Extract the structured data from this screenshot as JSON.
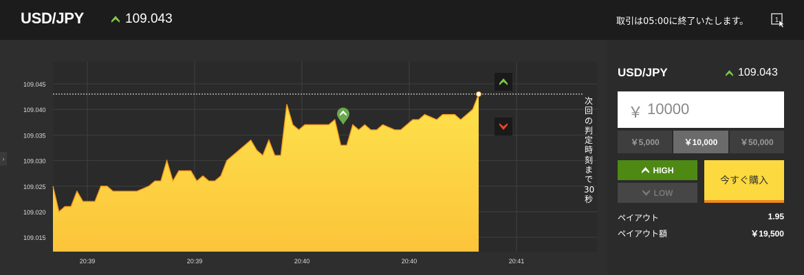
{
  "header": {
    "pair": "USD/JPY",
    "rate": "109.043",
    "message": "取引は05:00に終了いたします。",
    "window_icon_label": "1"
  },
  "chart": {
    "countdown_label": [
      "次",
      "回",
      "の",
      "判",
      "定",
      "時",
      "刻",
      "ま",
      "で",
      "30",
      "秒"
    ],
    "up_color": "#7ac943",
    "down_color": "#e8452c",
    "fill_color": "#fcd03a"
  },
  "panel": {
    "pair": "USD/JPY",
    "rate": "109.043",
    "currency_symbol": "￥",
    "amount": "10000",
    "presets": [
      "￥5,000",
      "￥10,000",
      "￥50,000"
    ],
    "active_preset": 1,
    "high_label": "HIGH",
    "low_label": "LOW",
    "buy_label": "今すぐ購入",
    "payout_label": "ペイアウト",
    "payout_value": "1.95",
    "payout_amount_label": "ペイアウト額",
    "payout_amount_value": "￥19,500"
  },
  "chart_data": {
    "type": "area",
    "y_ticks": [
      "109.045",
      "109.040",
      "109.035",
      "109.030",
      "109.025",
      "109.020",
      "109.015"
    ],
    "y_tick_values": [
      109.045,
      109.04,
      109.035,
      109.03,
      109.025,
      109.02,
      109.015
    ],
    "x_ticks": [
      "20:39",
      "20:39",
      "20:40",
      "20:40",
      "20:41"
    ],
    "ylim": [
      109.0122,
      109.0493
    ],
    "current_rate": 109.043,
    "marker_value": 109.037,
    "grid": true,
    "y": [
      109.025,
      109.02,
      109.021,
      109.021,
      109.024,
      109.022,
      109.022,
      109.022,
      109.025,
      109.025,
      109.024,
      109.024,
      109.024,
      109.024,
      109.024,
      109.0245,
      109.025,
      109.026,
      109.026,
      109.03,
      109.026,
      109.028,
      109.028,
      109.028,
      109.026,
      109.027,
      109.026,
      109.026,
      109.027,
      109.03,
      109.031,
      109.032,
      109.033,
      109.034,
      109.032,
      109.031,
      109.034,
      109.031,
      109.031,
      109.041,
      109.037,
      109.036,
      109.037,
      109.037,
      109.037,
      109.037,
      109.037,
      109.038,
      109.033,
      109.033,
      109.037,
      109.036,
      109.037,
      109.036,
      109.036,
      109.037,
      109.0365,
      109.036,
      109.036,
      109.037,
      109.038,
      109.038,
      109.039,
      109.0385,
      109.038,
      109.039,
      109.039,
      109.039,
      109.038,
      109.039,
      109.04,
      109.043
    ]
  }
}
